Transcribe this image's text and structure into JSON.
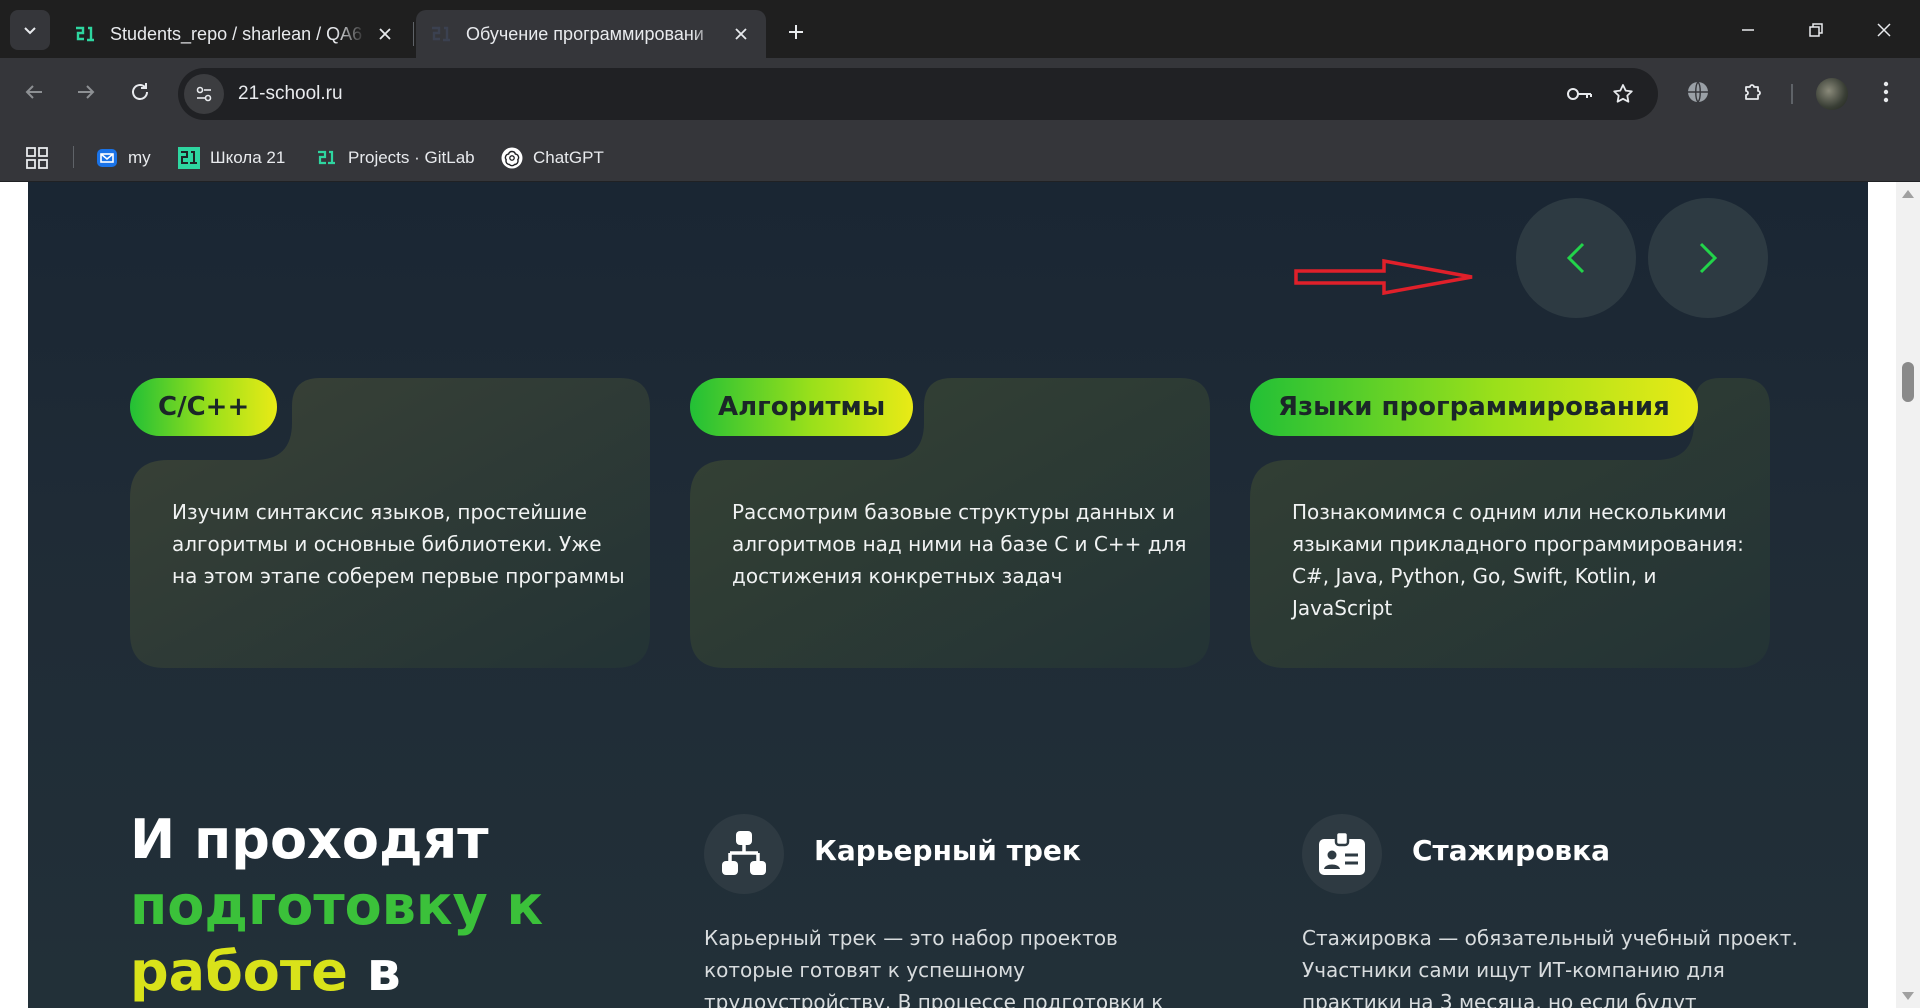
{
  "browser": {
    "tabs": [
      {
        "title": "Students_repo / sharlean / QA6",
        "favicon": "school21-logo-icon",
        "active": false
      },
      {
        "title": "Обучение программировани",
        "favicon": "school21-logo-icon",
        "active": true
      }
    ],
    "url": "21-school.ru",
    "bookmarks": [
      {
        "label": "my",
        "icon": "mail-icon"
      },
      {
        "label": "Школа 21",
        "icon": "school21-logo-icon"
      },
      {
        "label": "Projects · GitLab",
        "icon": "school21-logo-icon"
      },
      {
        "label": "ChatGPT",
        "icon": "chatgpt-icon"
      }
    ]
  },
  "colors": {
    "accent_green": "#22c036",
    "accent_yellow": "#e9ea16",
    "arrow_green": "#22d34a",
    "annotation_red": "#e0202a",
    "page_bg": "#1f2b36"
  },
  "carousel": {
    "prev_icon": "chevron-left-icon",
    "next_icon": "chevron-right-icon"
  },
  "cards": [
    {
      "pill": "C/C++",
      "text": "Изучим синтаксис языков, простейшие алгоритмы и основные библиотеки. Уже на этом этапе соберем первые программы"
    },
    {
      "pill": "Алгоритмы",
      "text": "Рассмотрим базовые структуры данных и алгоритмов над ними на базе С и С++ для достижения конкретных задач"
    },
    {
      "pill": "Языки программирования",
      "text": "Познакомимся с одним или несколькими языками прикладного программирования: C#, Java, Python, Go, Swift, Kotlin, и JavaScript"
    }
  ],
  "headline": {
    "part1": "И проходят",
    "part2": "подготовку к",
    "part3": "работе",
    "part4": "в"
  },
  "features": [
    {
      "title": "Карьерный трек",
      "icon": "org-chart-icon",
      "text": "Карьерный трек — это набор проектов которые готовят к успешному трудоустройству. В процессе подготовки к стажировке и корпоративной работе"
    },
    {
      "title": "Стажировка",
      "icon": "id-badge-icon",
      "text": "Стажировка — обязательный учебный проект. Участники сами ищут ИТ-компанию для практики на 3 месяца, но если будут трудности, школа"
    }
  ]
}
